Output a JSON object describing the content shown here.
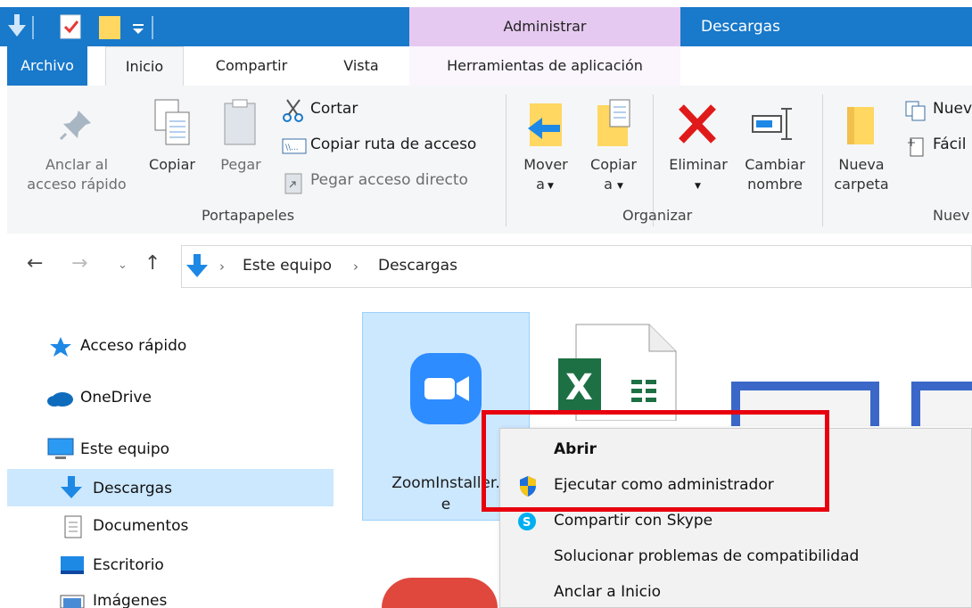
{
  "qat": {
    "icons": [
      "download-icon",
      "properties-check-icon",
      "folder-icon",
      "qat-dropdown-icon"
    ]
  },
  "title": {
    "context_group": "Administrar",
    "window_title": "Descargas"
  },
  "tabs": {
    "archivo": "Archivo",
    "inicio": "Inicio",
    "compartir": "Compartir",
    "vista": "Vista",
    "herramientas": "Herramientas de aplicación"
  },
  "ribbon": {
    "pin_label_1": "Anclar al",
    "pin_label_2": "acceso rápido",
    "copy": "Copiar",
    "paste": "Pegar",
    "cut": "Cortar",
    "copy_path": "Copiar ruta de acceso",
    "paste_shortcut": "Pegar acceso directo",
    "group_clipboard": "Portapapeles",
    "move_1": "Mover",
    "move_2": "a",
    "copyto_1": "Copiar",
    "copyto_2": "a",
    "delete": "Eliminar",
    "rename_1": "Cambiar",
    "rename_2": "nombre",
    "group_organize": "Organizar",
    "newfolder_1": "Nueva",
    "newfolder_2": "carpeta",
    "new_item": "Nuev",
    "easy_access": "Fácil",
    "group_new": "Nuev"
  },
  "address": {
    "crumb1": "Este equipo",
    "crumb2": "Descargas"
  },
  "nav": {
    "quick_access": "Acceso rápido",
    "onedrive": "OneDrive",
    "this_pc": "Este equipo",
    "downloads": "Descargas",
    "documents": "Documentos",
    "desktop": "Escritorio",
    "images": "Imágenes"
  },
  "files": {
    "zoom_name_1": "ZoomInstaller.",
    "zoom_name_2": "e"
  },
  "context_menu": {
    "open": "Abrir",
    "run_admin": "Ejecutar como administrador",
    "share_skype": "Compartir con Skype",
    "troubleshoot": "Solucionar problemas de compatibilidad",
    "pin_start": "Anclar a Inicio"
  },
  "colors": {
    "accent": "#1979ca",
    "context_tab": "#e6c9f0",
    "selection": "#cce8ff",
    "highlight_box": "#e8000e"
  }
}
